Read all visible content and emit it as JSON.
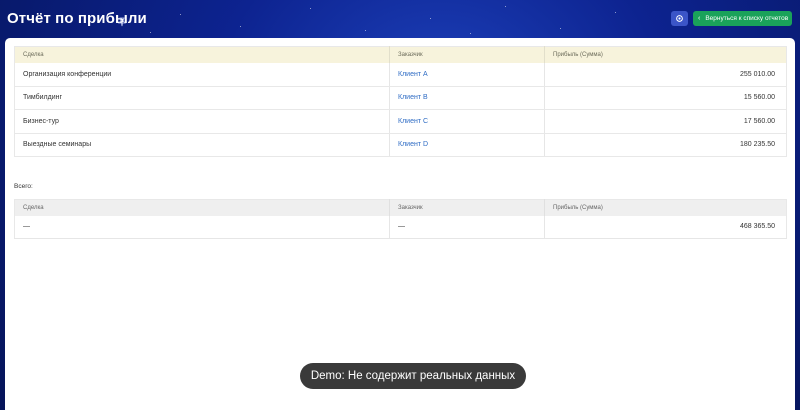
{
  "header": {
    "title": "Отчёт по прибыли",
    "back_label": "Вернуться к списку отчетов"
  },
  "table": {
    "columns": [
      "Сделка",
      "Заказчик",
      "Прибыль (Сумма)"
    ],
    "rows": [
      {
        "deal": "Организация конференции",
        "client": "Клиент А",
        "profit": "255 010.00"
      },
      {
        "deal": "Тимбилдинг",
        "client": "Клиент B",
        "profit": "15 560.00"
      },
      {
        "deal": "Бизнес-тур",
        "client": "Клиент C",
        "profit": "17 560.00"
      },
      {
        "deal": "Выездные семинары",
        "client": "Клиент D",
        "profit": "180 235.50"
      }
    ]
  },
  "totals": {
    "label": "Всего:",
    "columns": [
      "Сделка",
      "Заказчик",
      "Прибыль (Сумма)"
    ],
    "deal": "—",
    "client": "—",
    "profit": "468 365.50"
  },
  "toast": "Demo: Не содержит реальных данных",
  "colors": {
    "background": "#0d2390",
    "accent_green": "#1aa25a",
    "settings_blue": "#3b55c8",
    "link": "#2f6cc4"
  },
  "icons": [
    "pin-icon",
    "settings-icon",
    "chevron-left-icon"
  ]
}
